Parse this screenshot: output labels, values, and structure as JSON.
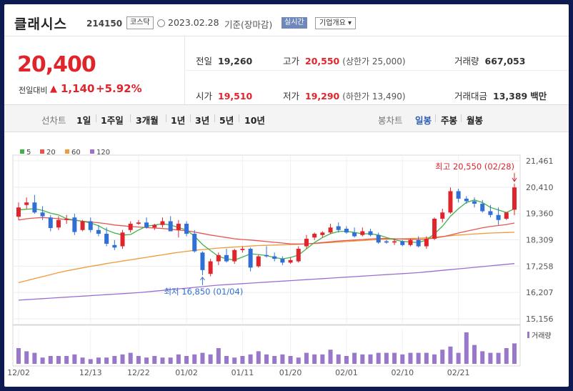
{
  "header": {
    "name": "클래시스",
    "code": "214150",
    "market": "코스닥",
    "date": "2023.02.28",
    "date_note": "기준(장마감)",
    "realtime": "실시간",
    "overview": "기업개요 ▾"
  },
  "price": {
    "current": "20,400",
    "change_label": "전일대비",
    "change_arrow": "▲",
    "change": "1,140",
    "change_pct": "+5.92%"
  },
  "stats": {
    "prev_label": "전일",
    "prev": "19,260",
    "high_label": "고가",
    "high": "20,550",
    "upper_label": "(상한가 25,000)",
    "volume_label": "거래량",
    "volume": "667,053",
    "open_label": "시가",
    "open": "19,510",
    "low_label": "저가",
    "low": "19,290",
    "lower_label": "(하한가 13,490)",
    "amount_label": "거래대금",
    "amount": "13,389",
    "amount_unit": "백만"
  },
  "tabs": {
    "line": "선차트",
    "d1": "1일",
    "w1": "1주일",
    "m3": "3개월",
    "y1": "1년",
    "y3": "3년",
    "y5": "5년",
    "y10": "10년",
    "candle": "봉차트",
    "daily": "일봉",
    "weekly": "주봉",
    "monthly": "월봉"
  },
  "chart_data": {
    "type": "candlestick",
    "legend": [
      {
        "name": "5",
        "color": "#41b24a"
      },
      {
        "name": "20",
        "color": "#e8554e"
      },
      {
        "name": "60",
        "color": "#ee9b3b"
      },
      {
        "name": "120",
        "color": "#9b6fd0"
      }
    ],
    "y_ticks": [
      "21,461",
      "20,410",
      "19,360",
      "18,309",
      "17,258",
      "16,207",
      "15,156"
    ],
    "ylim": [
      15156,
      21461
    ],
    "x_ticks": [
      "12/02",
      "12/13",
      "12/22",
      "01/02",
      "01/11",
      "01/20",
      "02/01",
      "02/10",
      "02/21"
    ],
    "annotations": {
      "high": "최고 20,550 (02/28)",
      "low": "최저 16,850 (01/04)"
    },
    "volume_label": "거래량",
    "up_color": "#e0242b",
    "down_color": "#2f6fd6",
    "candles": [
      {
        "o": 19230,
        "h": 19800,
        "l": 19100,
        "c": 19600
      },
      {
        "o": 19700,
        "h": 20000,
        "l": 19550,
        "c": 19800
      },
      {
        "o": 19800,
        "h": 20100,
        "l": 19350,
        "c": 19400
      },
      {
        "o": 19400,
        "h": 19650,
        "l": 19100,
        "c": 19250
      },
      {
        "o": 19200,
        "h": 19300,
        "l": 18650,
        "c": 18780
      },
      {
        "o": 18800,
        "h": 19250,
        "l": 18700,
        "c": 19100
      },
      {
        "o": 19100,
        "h": 19300,
        "l": 18950,
        "c": 19150
      },
      {
        "o": 19200,
        "h": 19350,
        "l": 18500,
        "c": 18620
      },
      {
        "o": 18700,
        "h": 19100,
        "l": 18650,
        "c": 19050
      },
      {
        "o": 19050,
        "h": 19200,
        "l": 18600,
        "c": 18700
      },
      {
        "o": 18700,
        "h": 18900,
        "l": 18450,
        "c": 18550
      },
      {
        "o": 18550,
        "h": 18800,
        "l": 18050,
        "c": 18150
      },
      {
        "o": 18100,
        "h": 18300,
        "l": 17900,
        "c": 18000
      },
      {
        "o": 18050,
        "h": 18700,
        "l": 17950,
        "c": 18600
      },
      {
        "o": 18700,
        "h": 19050,
        "l": 18600,
        "c": 18950
      },
      {
        "o": 18950,
        "h": 19100,
        "l": 18900,
        "c": 19000
      },
      {
        "o": 19000,
        "h": 19200,
        "l": 18750,
        "c": 18800
      },
      {
        "o": 18800,
        "h": 18950,
        "l": 18700,
        "c": 18900
      },
      {
        "o": 18900,
        "h": 19200,
        "l": 18800,
        "c": 19050
      },
      {
        "o": 19050,
        "h": 19250,
        "l": 18650,
        "c": 18650
      },
      {
        "o": 18700,
        "h": 19100,
        "l": 18400,
        "c": 18950
      },
      {
        "o": 18950,
        "h": 19050,
        "l": 18450,
        "c": 18550
      },
      {
        "o": 18550,
        "h": 18700,
        "l": 17800,
        "c": 17850
      },
      {
        "o": 17800,
        "h": 17850,
        "l": 16900,
        "c": 17100
      },
      {
        "o": 16950,
        "h": 17550,
        "l": 16850,
        "c": 17450
      },
      {
        "o": 17450,
        "h": 17800,
        "l": 17300,
        "c": 17700
      },
      {
        "o": 17700,
        "h": 17950,
        "l": 17400,
        "c": 17450
      },
      {
        "o": 17450,
        "h": 17950,
        "l": 17350,
        "c": 17900
      },
      {
        "o": 17900,
        "h": 18050,
        "l": 17800,
        "c": 17950
      },
      {
        "o": 17950,
        "h": 18000,
        "l": 17050,
        "c": 17200
      },
      {
        "o": 17250,
        "h": 17700,
        "l": 17200,
        "c": 17650
      },
      {
        "o": 17700,
        "h": 18050,
        "l": 17600,
        "c": 17650
      },
      {
        "o": 17650,
        "h": 17800,
        "l": 17450,
        "c": 17550
      },
      {
        "o": 17550,
        "h": 17650,
        "l": 17300,
        "c": 17400
      },
      {
        "o": 17400,
        "h": 17600,
        "l": 17350,
        "c": 17500
      },
      {
        "o": 17450,
        "h": 18050,
        "l": 17400,
        "c": 17950
      },
      {
        "o": 18050,
        "h": 18500,
        "l": 17950,
        "c": 18350
      },
      {
        "o": 18400,
        "h": 18600,
        "l": 18300,
        "c": 18550
      },
      {
        "o": 18500,
        "h": 18650,
        "l": 18400,
        "c": 18600
      },
      {
        "o": 18600,
        "h": 18950,
        "l": 18550,
        "c": 18800
      },
      {
        "o": 18850,
        "h": 19000,
        "l": 18600,
        "c": 18700
      },
      {
        "o": 18750,
        "h": 18850,
        "l": 18550,
        "c": 18600
      },
      {
        "o": 18600,
        "h": 18800,
        "l": 18400,
        "c": 18450
      },
      {
        "o": 18500,
        "h": 18800,
        "l": 18450,
        "c": 18650
      },
      {
        "o": 18650,
        "h": 18750,
        "l": 18450,
        "c": 18500
      },
      {
        "o": 18500,
        "h": 18600,
        "l": 18150,
        "c": 18200
      },
      {
        "o": 18250,
        "h": 18300,
        "l": 18150,
        "c": 18200
      },
      {
        "o": 18200,
        "h": 18350,
        "l": 18100,
        "c": 18250
      },
      {
        "o": 18250,
        "h": 18300,
        "l": 18050,
        "c": 18100
      },
      {
        "o": 18100,
        "h": 18350,
        "l": 18050,
        "c": 18300
      },
      {
        "o": 18300,
        "h": 18450,
        "l": 18000,
        "c": 18050
      },
      {
        "o": 18050,
        "h": 18450,
        "l": 17950,
        "c": 18350
      },
      {
        "o": 18350,
        "h": 19200,
        "l": 18300,
        "c": 19150
      },
      {
        "o": 19150,
        "h": 19550,
        "l": 19000,
        "c": 19400
      },
      {
        "o": 19400,
        "h": 20400,
        "l": 19350,
        "c": 20250
      },
      {
        "o": 20250,
        "h": 20350,
        "l": 19800,
        "c": 19950
      },
      {
        "o": 19950,
        "h": 20050,
        "l": 19750,
        "c": 19850
      },
      {
        "o": 19850,
        "h": 20000,
        "l": 19600,
        "c": 19750
      },
      {
        "o": 19750,
        "h": 19900,
        "l": 19400,
        "c": 19450
      },
      {
        "o": 19450,
        "h": 19700,
        "l": 19200,
        "c": 19300
      },
      {
        "o": 19300,
        "h": 19600,
        "l": 18900,
        "c": 19100
      },
      {
        "o": 19150,
        "h": 19400,
        "l": 19100,
        "c": 19400
      },
      {
        "o": 19510,
        "h": 20550,
        "l": 19290,
        "c": 20400
      }
    ],
    "ma5": [
      19500,
      19530,
      19550,
      19480,
      19370,
      19300,
      19150,
      19100,
      19050,
      18980,
      18870,
      18700,
      18580,
      18500,
      18520,
      18700,
      18850,
      18900,
      18950,
      18900,
      18800,
      18700,
      18450,
      18120,
      17880,
      17650,
      17550,
      17500,
      17620,
      17750,
      17720,
      17680,
      17600,
      17550,
      17600,
      17700,
      17950,
      18200,
      18400,
      18550,
      18640,
      18650,
      18600,
      18550,
      18550,
      18500,
      18400,
      18310,
      18250,
      18220,
      18200,
      18300,
      18550,
      18850,
      19250,
      19550,
      19800,
      19900,
      19800,
      19600,
      19500,
      19400,
      19550
    ],
    "ma20": [
      19100,
      19150,
      19180,
      19200,
      19180,
      19150,
      19120,
      19090,
      19050,
      19020,
      18990,
      18950,
      18900,
      18870,
      18840,
      18820,
      18800,
      18780,
      18760,
      18730,
      18700,
      18670,
      18620,
      18560,
      18500,
      18450,
      18400,
      18350,
      18320,
      18300,
      18270,
      18240,
      18210,
      18180,
      18150,
      18140,
      18150,
      18170,
      18200,
      18230,
      18260,
      18280,
      18300,
      18320,
      18340,
      18360,
      18360,
      18350,
      18340,
      18330,
      18320,
      18340,
      18380,
      18430,
      18500,
      18580,
      18650,
      18720,
      18790,
      18840,
      18880,
      18920,
      18980
    ],
    "ma60": [
      16600,
      16680,
      16760,
      16840,
      16920,
      17000,
      17070,
      17130,
      17190,
      17250,
      17300,
      17360,
      17410,
      17460,
      17510,
      17560,
      17610,
      17660,
      17710,
      17760,
      17810,
      17850,
      17890,
      17920,
      17950,
      17980,
      18000,
      18020,
      18040,
      18060,
      18080,
      18090,
      18100,
      18110,
      18120,
      18130,
      18140,
      18160,
      18180,
      18200,
      18220,
      18240,
      18260,
      18280,
      18300,
      18320,
      18330,
      18340,
      18350,
      18360,
      18370,
      18390,
      18410,
      18440,
      18470,
      18500,
      18520,
      18540,
      18560,
      18580,
      18590,
      18600,
      18610
    ],
    "ma120": [
      15900,
      15920,
      15940,
      15960,
      15980,
      16000,
      16020,
      16040,
      16060,
      16080,
      16100,
      16120,
      16140,
      16160,
      16180,
      16200,
      16230,
      16260,
      16290,
      16320,
      16350,
      16380,
      16410,
      16440,
      16470,
      16500,
      16520,
      16540,
      16560,
      16580,
      16600,
      16620,
      16640,
      16660,
      16680,
      16700,
      16720,
      16740,
      16760,
      16780,
      16800,
      16820,
      16840,
      16860,
      16880,
      16900,
      16920,
      16940,
      16960,
      16980,
      17000,
      17030,
      17060,
      17090,
      17120,
      17150,
      17180,
      17210,
      17240,
      17270,
      17300,
      17330,
      17360
    ],
    "volumes": [
      0.5,
      0.4,
      0.35,
      0.2,
      0.25,
      0.25,
      0.25,
      0.3,
      0.2,
      0.15,
      0.2,
      0.2,
      0.25,
      0.3,
      0.35,
      0.25,
      0.2,
      0.25,
      0.2,
      0.2,
      0.3,
      0.25,
      0.3,
      0.35,
      0.3,
      0.5,
      0.25,
      0.2,
      0.25,
      0.3,
      0.4,
      0.3,
      0.25,
      0.3,
      0.25,
      0.2,
      0.35,
      0.3,
      0.3,
      0.45,
      0.3,
      0.25,
      0.35,
      0.3,
      0.3,
      0.35,
      0.35,
      0.35,
      0.3,
      0.35,
      0.35,
      0.35,
      0.3,
      0.45,
      0.55,
      0.35,
      1.0,
      0.6,
      0.4,
      0.35,
      0.35,
      0.5,
      0.65
    ]
  }
}
